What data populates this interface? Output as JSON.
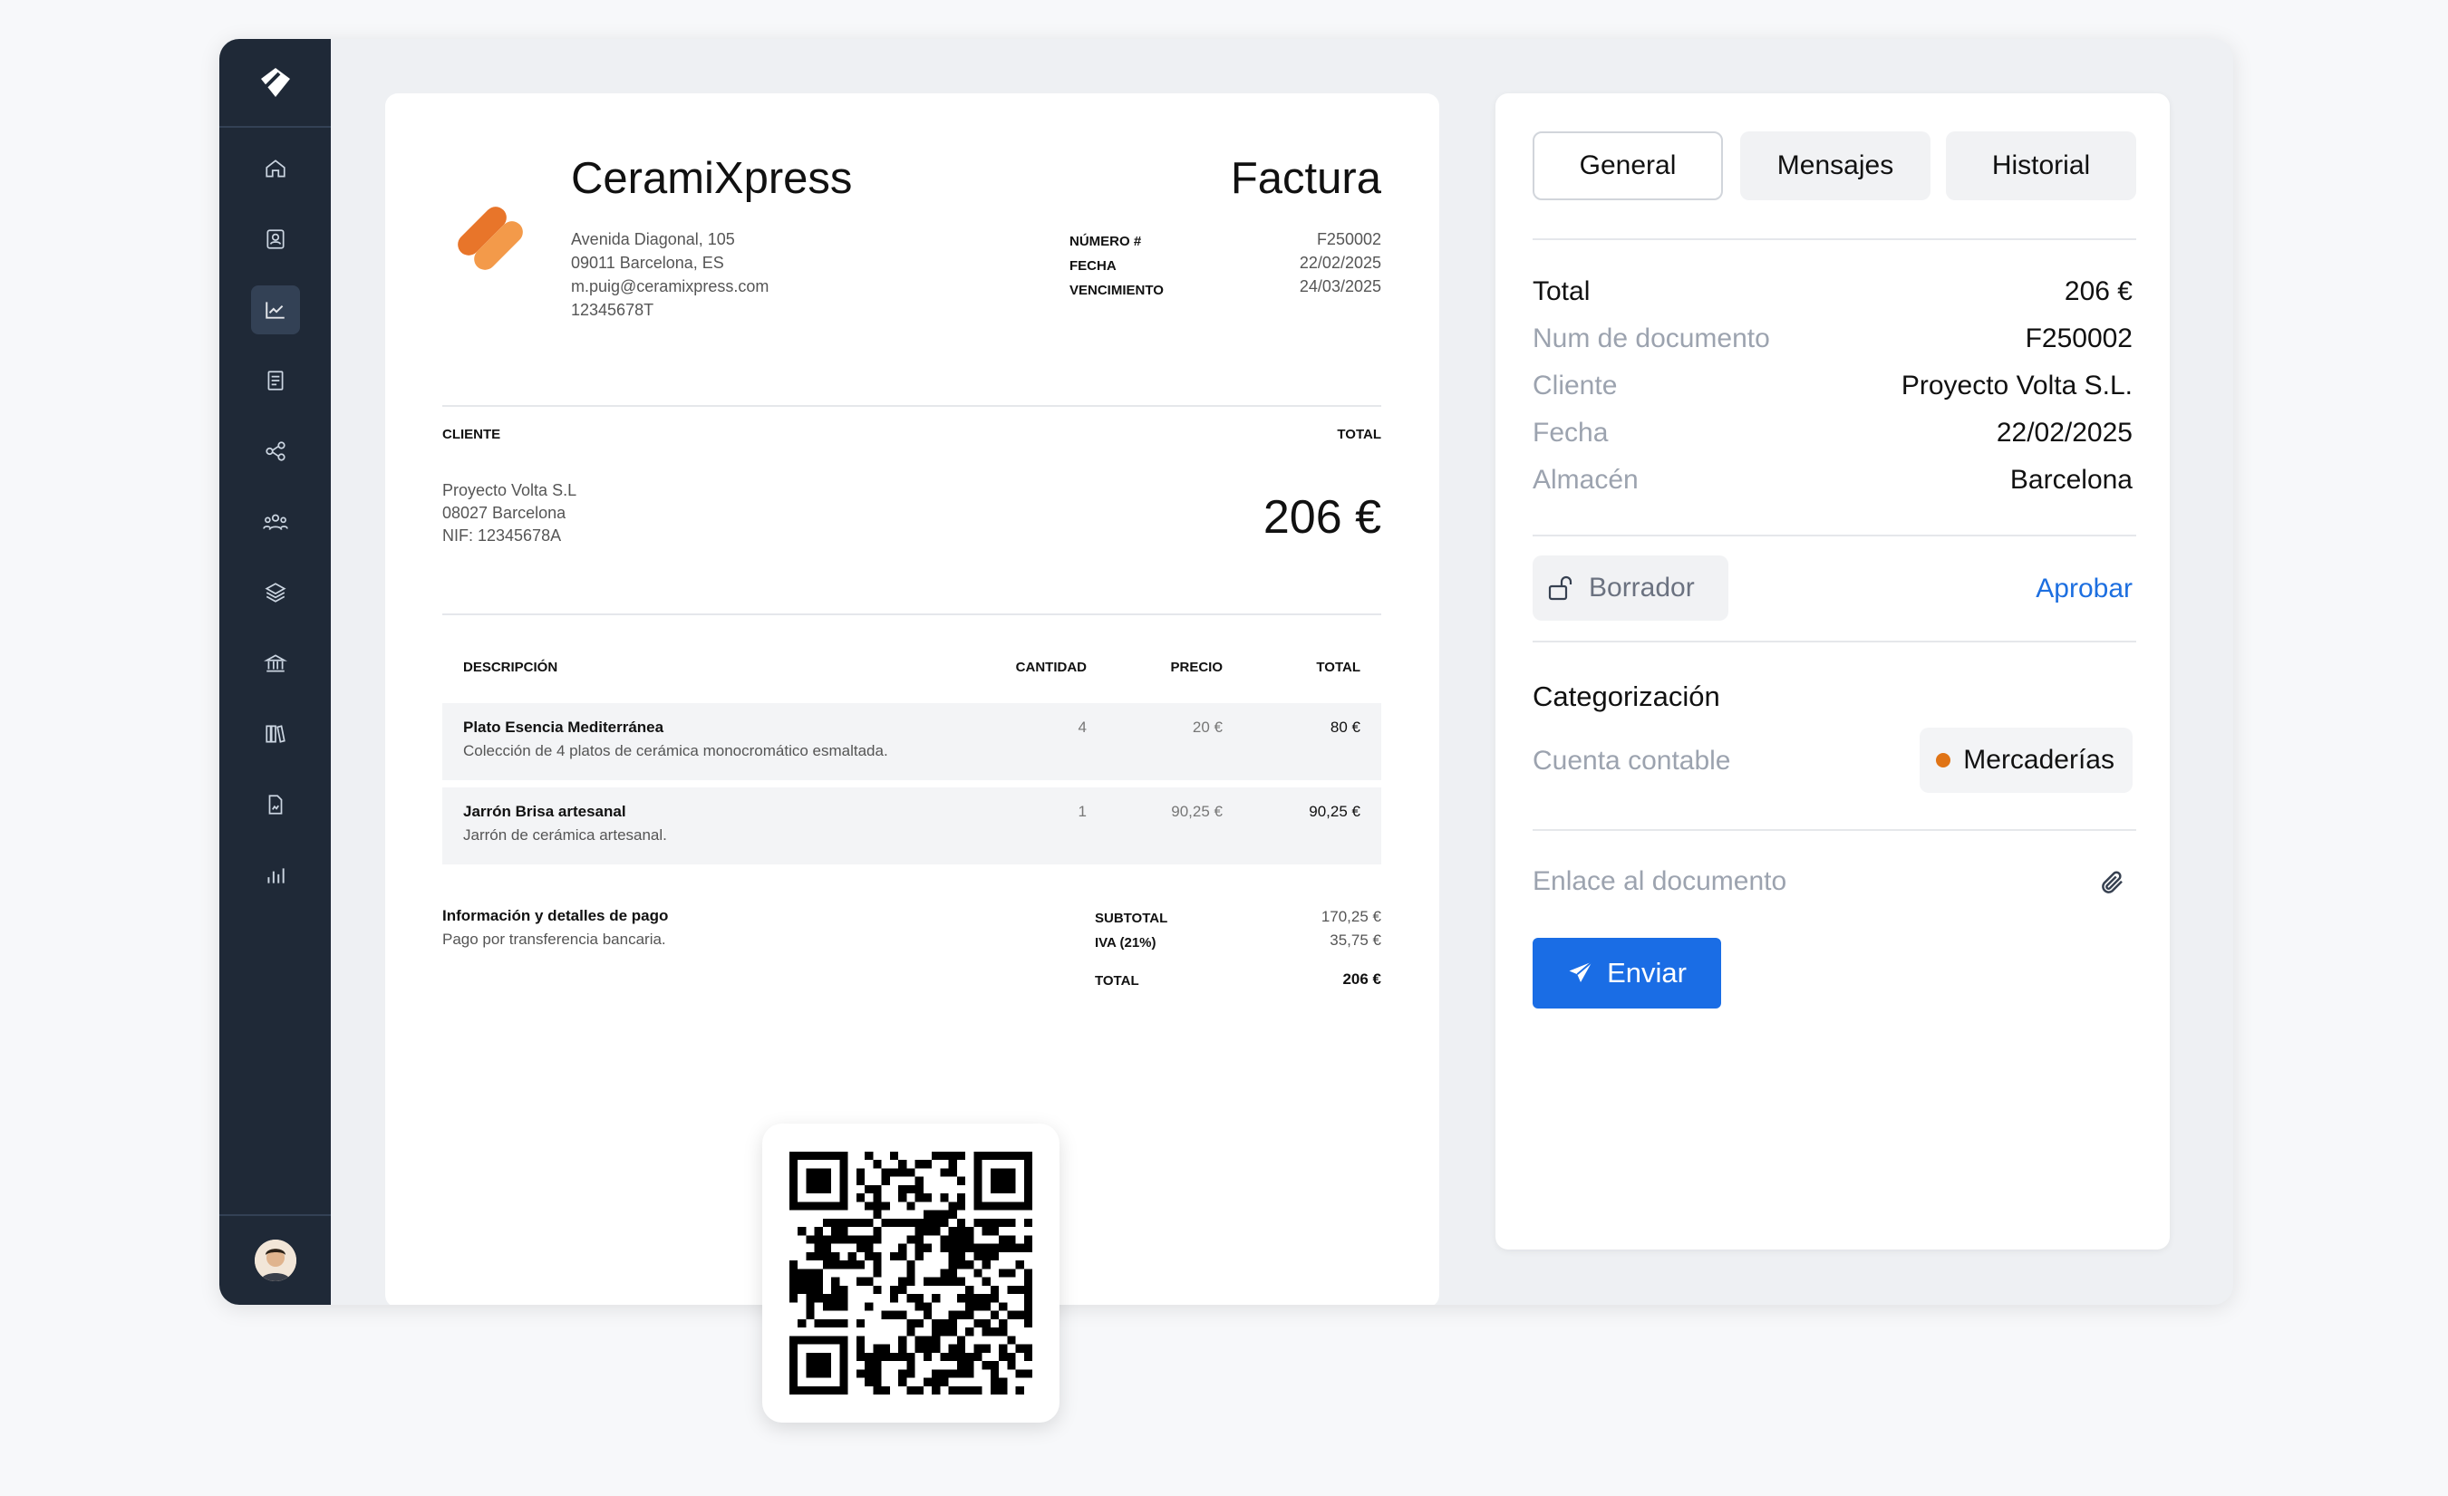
{
  "colors": {
    "sidebar": "#1f2937",
    "accent": "#1a6de5",
    "logo_orange": "#f08a2c",
    "category_dot": "#e07416"
  },
  "sidebar": {
    "items": [
      {
        "icon": "home-icon"
      },
      {
        "icon": "contacts-icon"
      },
      {
        "icon": "chart-line-icon",
        "active": true
      },
      {
        "icon": "receipt-icon"
      },
      {
        "icon": "share-nodes-icon"
      },
      {
        "icon": "team-icon"
      },
      {
        "icon": "layers-icon"
      },
      {
        "icon": "bank-icon"
      },
      {
        "icon": "library-icon"
      },
      {
        "icon": "document-image-icon"
      },
      {
        "icon": "bar-chart-icon"
      }
    ],
    "user_icon": "user-avatar"
  },
  "invoice": {
    "company": "CeramiXpress",
    "address": [
      "Avenida Diagonal, 105",
      "09011 Barcelona, ES",
      "m.puig@ceramixpress.com",
      "12345678T"
    ],
    "title": "Factura",
    "meta": {
      "number_label": "NÚMERO #",
      "number": "F250002",
      "date_label": "FECHA",
      "date": "22/02/2025",
      "due_label": "VENCIMIENTO",
      "due": "24/03/2025"
    },
    "client_label": "CLIENTE",
    "client": [
      "Proyecto Volta S.L",
      "08027 Barcelona",
      "NIF: 12345678A"
    ],
    "total_label": "TOTAL",
    "total": "206 €",
    "columns": {
      "desc": "DESCRIPCIÓN",
      "qty": "CANTIDAD",
      "price": "PRECIO",
      "total": "TOTAL"
    },
    "items": [
      {
        "name": "Plato Esencia Mediterránea",
        "desc": "Colección de 4 platos de cerámica monocromático esmaltada.",
        "qty": "4",
        "price": "20 €",
        "total": "80 €"
      },
      {
        "name": "Jarrón Brisa artesanal",
        "desc": "Jarrón de cerámica artesanal.",
        "qty": "1",
        "price": "90,25 €",
        "total": "90,25 €"
      }
    ],
    "payment": {
      "title": "Información y detalles de pago",
      "desc": "Pago por transferencia bancaria."
    },
    "summary": {
      "subtotal_label": "SUBTOTAL",
      "subtotal": "170,25 €",
      "iva_label": "IVA (21%)",
      "iva": "35,75 €",
      "total_label": "TOTAL",
      "total": "206 €"
    }
  },
  "panel": {
    "tabs": [
      {
        "label": "General",
        "active": true
      },
      {
        "label": "Mensajes"
      },
      {
        "label": "Historial"
      }
    ],
    "details": [
      {
        "key": "Total",
        "value": "206 €"
      },
      {
        "key": "Num de documento",
        "value": "F250002"
      },
      {
        "key": "Cliente",
        "value": "Proyecto Volta S.L."
      },
      {
        "key": "Fecha",
        "value": "22/02/2025"
      },
      {
        "key": "Almacén",
        "value": "Barcelona"
      }
    ],
    "status": {
      "label": "Borrador",
      "icon": "unlock-icon",
      "action": "Aprobar"
    },
    "categorization": {
      "title": "Categorización",
      "account_label": "Cuenta contable",
      "account_value": "Mercaderías"
    },
    "document_link": {
      "label": "Enlace al documento",
      "icon": "paperclip-icon"
    },
    "send": {
      "label": "Enviar",
      "icon": "send-icon"
    }
  }
}
